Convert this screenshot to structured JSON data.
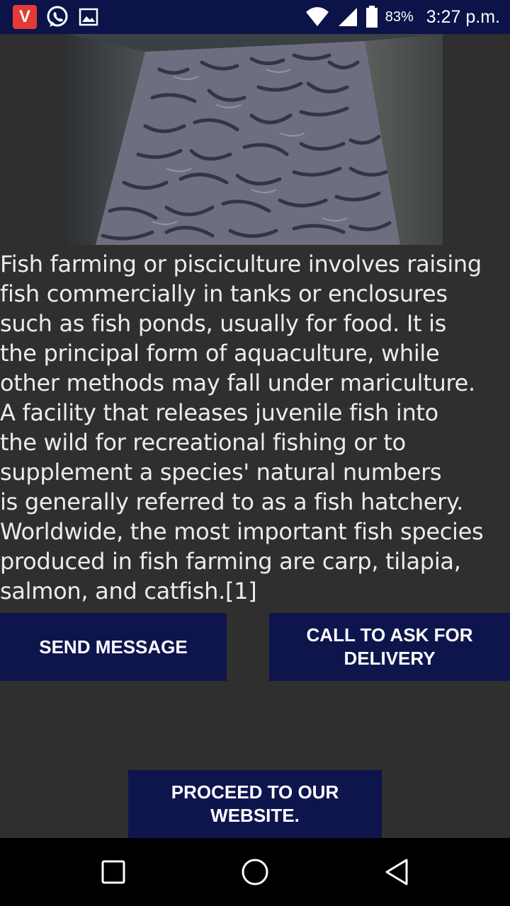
{
  "status_bar": {
    "app_icon_letter": "V",
    "icons": [
      "vidmate-icon",
      "whatsapp-icon",
      "image-icon",
      "wifi-icon",
      "signal-icon",
      "battery-icon"
    ],
    "battery_percent": "83%",
    "time": "3:27 p.m."
  },
  "content": {
    "image_alt": "catfish tank",
    "description_lines": [
      "Fish farming or pisciculture involves raising",
      "fish commercially in tanks or enclosures",
      "such as fish ponds, usually for food. It is",
      "the principal form of aquaculture, while",
      "other methods may fall under mariculture.",
      "A facility that releases juvenile fish into",
      "the wild for recreational fishing or to",
      "supplement a species' natural numbers",
      "is generally referred to as a fish hatchery.",
      "Worldwide, the most important fish species",
      "produced in fish farming are carp, tilapia,",
      "salmon, and catfish.[1]"
    ]
  },
  "buttons": {
    "send_message": "SEND MESSAGE",
    "call_delivery": "CALL TO ASK FOR DELIVERY",
    "proceed_website": "PROCEED TO OUR WEBSITE."
  },
  "colors": {
    "status_bar": "#0c1348",
    "background": "#2f2f2f",
    "button": "#0e154d",
    "nav_bar": "#000000"
  }
}
